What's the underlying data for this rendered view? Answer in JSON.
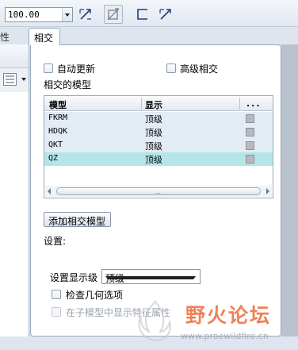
{
  "toolbar": {
    "zoom_value": "100.00",
    "icons": [
      "scale-dimension-icon",
      "reference-plane-icon",
      "corner-bracket-icon",
      "scale-dimension-icon"
    ]
  },
  "left_panel": {
    "tab_label_partial": "属性",
    "icons": [
      "list-view-icon"
    ]
  },
  "tab": {
    "label": "相交"
  },
  "panel": {
    "auto_update_label": "自动更新",
    "advanced_intersect_label": "高级相交",
    "intersected_models_label": "相交的模型",
    "table": {
      "columns": [
        "模型",
        "显示",
        "..."
      ],
      "rows": [
        {
          "model": "FKRM",
          "display": "顶级",
          "selected": false
        },
        {
          "model": "HDQK",
          "display": "顶级",
          "selected": false
        },
        {
          "model": "QKT",
          "display": "顶级",
          "selected": false
        },
        {
          "model": "QZ",
          "display": "顶级",
          "selected": true
        }
      ],
      "scroll_grip": "…"
    },
    "add_button_label": "添加相交模型",
    "settings_label": "设置:",
    "display_level_label": "设置显示级",
    "display_level_value": "顶级",
    "check_geometry_label": "检查几何选项",
    "show_in_submodel_label": "在子模型中显示特征属性"
  },
  "watermark": {
    "text": "野火论坛",
    "url": "www.proewildfire.cn"
  },
  "colors": {
    "selected_row": "#b4e5e8",
    "row_bg": "#e3ebf4",
    "panel_border": "#9aa9bd",
    "watermark": "#ec5c2a"
  }
}
